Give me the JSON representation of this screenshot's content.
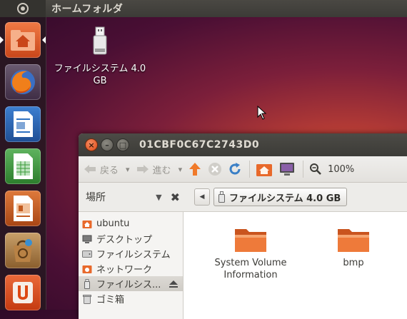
{
  "top_panel": {
    "title": "ホームフォルダ"
  },
  "launcher": {
    "items": [
      {
        "icon": "home-folder-icon",
        "color": "#e05a24",
        "active": true
      },
      {
        "icon": "firefox-icon",
        "color": "#e66000"
      },
      {
        "icon": "libreoffice-writer-icon",
        "color": "#2e72c2"
      },
      {
        "icon": "libreoffice-calc-icon",
        "color": "#3a9a3a"
      },
      {
        "icon": "libreoffice-impress-icon",
        "color": "#c25a1f"
      },
      {
        "icon": "ubuntu-software-center-icon",
        "color": "#a07033"
      },
      {
        "icon": "ubuntu-one-icon",
        "color": "#dd4814"
      }
    ]
  },
  "desktop": {
    "usb_drive_label": "ファイルシステム 4.0 GB"
  },
  "window": {
    "title": "01CBF0C67C2743D0",
    "toolbar": {
      "back": "戻る",
      "forward": "進む",
      "zoom": "100%"
    },
    "places_header": "場所",
    "breadcrumb": "ファイルシステム 4.0 GB",
    "sidebar": [
      {
        "label": "ubuntu",
        "icon": "home-icon"
      },
      {
        "label": "デスクトップ",
        "icon": "desktop-icon"
      },
      {
        "label": "ファイルシステム",
        "icon": "harddisk-icon"
      },
      {
        "label": "ネットワーク",
        "icon": "network-icon"
      },
      {
        "label": "ファイルシス...",
        "icon": "usb-drive-icon",
        "selected": true
      },
      {
        "label": "ゴミ箱",
        "icon": "trash-icon"
      }
    ],
    "files": [
      {
        "name": "System Volume Information",
        "icon": "folder-icon"
      },
      {
        "name": "bmp",
        "icon": "folder-icon"
      }
    ]
  },
  "colors": {
    "accent": "#dd4814",
    "panel": "#3c3b37",
    "folder_orange": "#e8692b"
  }
}
